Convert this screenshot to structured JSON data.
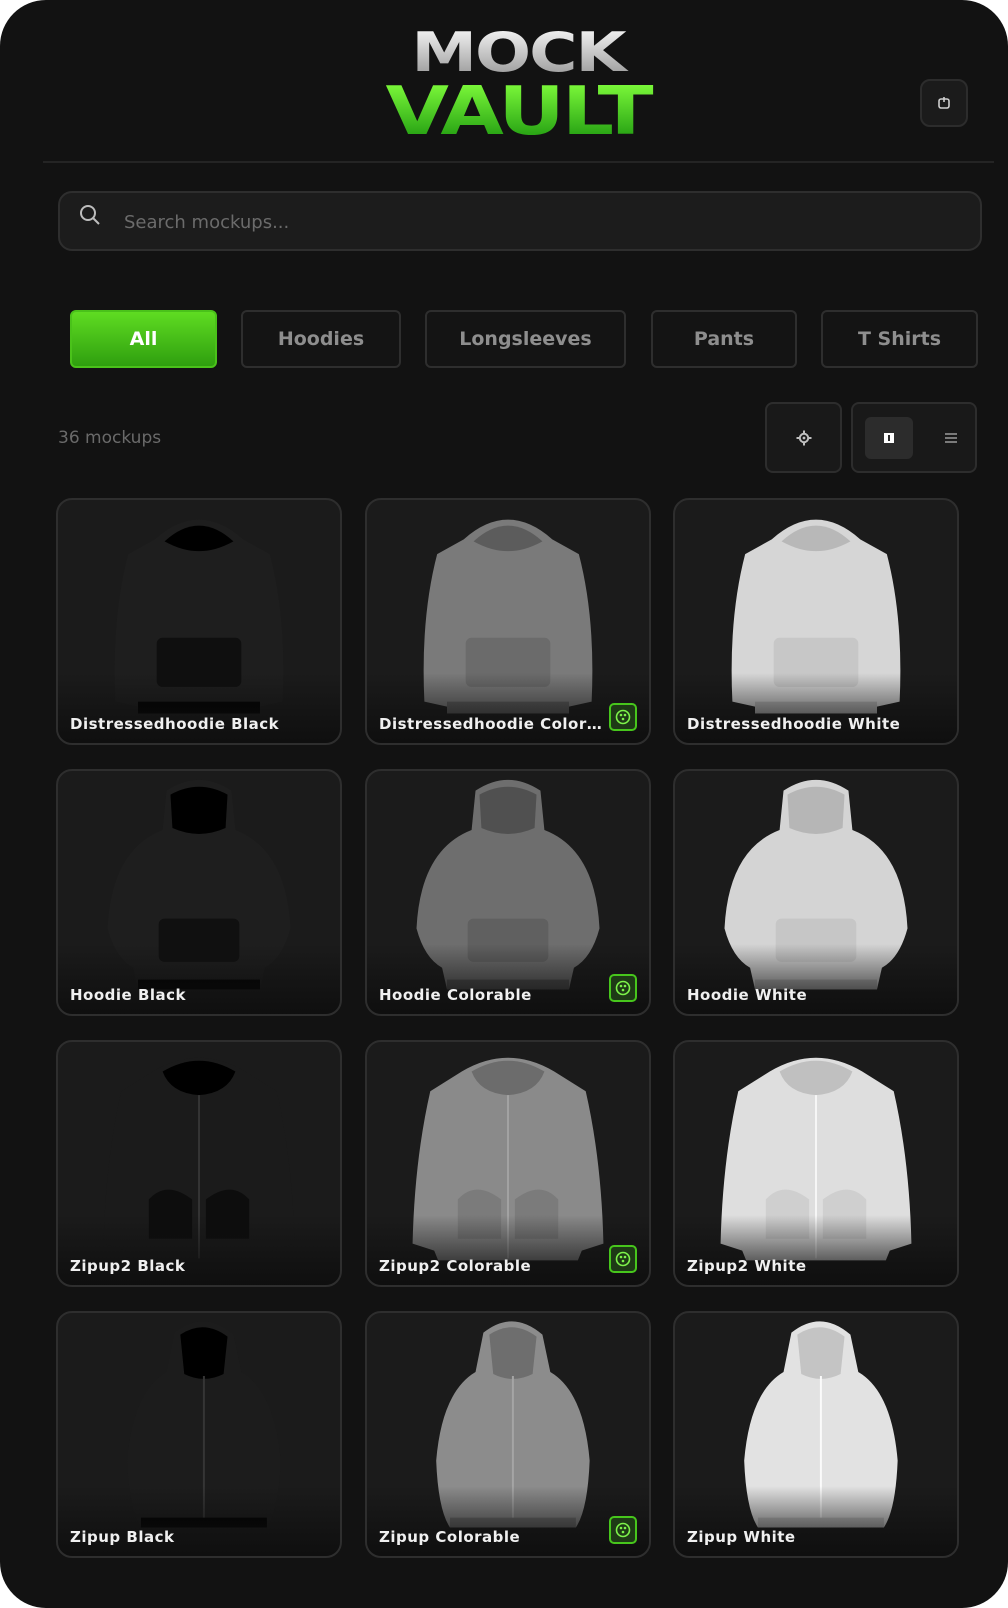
{
  "brand": {
    "logo_top": "MOCK",
    "logo_bottom": "VAULT",
    "accent_color": "#4fd11e"
  },
  "header": {
    "logout_icon": "logout-icon"
  },
  "search": {
    "placeholder": "Search mockups...",
    "value": ""
  },
  "filters": {
    "selected": "All",
    "tabs": [
      {
        "label": "All"
      },
      {
        "label": "Hoodies"
      },
      {
        "label": "Longsleeves"
      },
      {
        "label": "Pants"
      },
      {
        "label": "T Shirts"
      }
    ]
  },
  "toolbar": {
    "count": "36 mockups",
    "settings_icon": "gear-icon",
    "view_modes": [
      "grid",
      "list"
    ],
    "selected_view": "grid"
  },
  "mockups": [
    {
      "title": "Distressedhoodie Black",
      "shade": "#1e1e1e",
      "style": "hoodie",
      "colorable": false
    },
    {
      "title": "Distressedhoodie Colorable",
      "shade": "#7a7a7a",
      "style": "hoodie",
      "colorable": true
    },
    {
      "title": "Distressedhoodie White",
      "shade": "#d6d6d6",
      "style": "hoodie",
      "colorable": false
    },
    {
      "title": "Hoodie Black",
      "shade": "#1e1e1e",
      "style": "oversize",
      "colorable": false
    },
    {
      "title": "Hoodie Colorable",
      "shade": "#6e6e6e",
      "style": "oversize",
      "colorable": true
    },
    {
      "title": "Hoodie White",
      "shade": "#d4d4d4",
      "style": "oversize",
      "colorable": false
    },
    {
      "title": "Zipup2 Black",
      "shade": "#1b1b1b",
      "style": "zip",
      "colorable": false
    },
    {
      "title": "Zipup2 Colorable",
      "shade": "#8a8a8a",
      "style": "zip",
      "colorable": true
    },
    {
      "title": "Zipup2 White",
      "shade": "#dedede",
      "style": "zip",
      "colorable": false
    },
    {
      "title": "Zipup Black",
      "shade": "#1c1c1c",
      "style": "zipslim",
      "colorable": false
    },
    {
      "title": "Zipup Colorable",
      "shade": "#8c8c8c",
      "style": "zipslim",
      "colorable": true
    },
    {
      "title": "Zipup White",
      "shade": "#e2e2e2",
      "style": "zipslim",
      "colorable": false
    }
  ]
}
